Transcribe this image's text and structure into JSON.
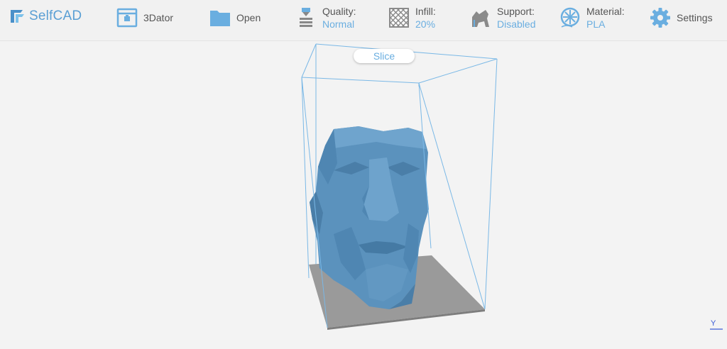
{
  "app": {
    "logo_text": "SelfCAD"
  },
  "toolbar": {
    "printer": {
      "label": "3Dator"
    },
    "open": {
      "label": "Open"
    },
    "quality": {
      "label": "Quality:",
      "value": "Normal"
    },
    "infill": {
      "label": "Infill:",
      "value": "20%"
    },
    "support": {
      "label": "Support:",
      "value": "Disabled"
    },
    "material": {
      "label": "Material:",
      "value": "PLA"
    },
    "settings": {
      "label": "Settings"
    }
  },
  "viewport": {
    "slice_label": "Slice",
    "axis_label": "Y"
  },
  "colors": {
    "accent": "#6aaee0",
    "model": "#5b92bd",
    "bed": "#9a9a9a",
    "build_volume": "#7ab8e6"
  }
}
